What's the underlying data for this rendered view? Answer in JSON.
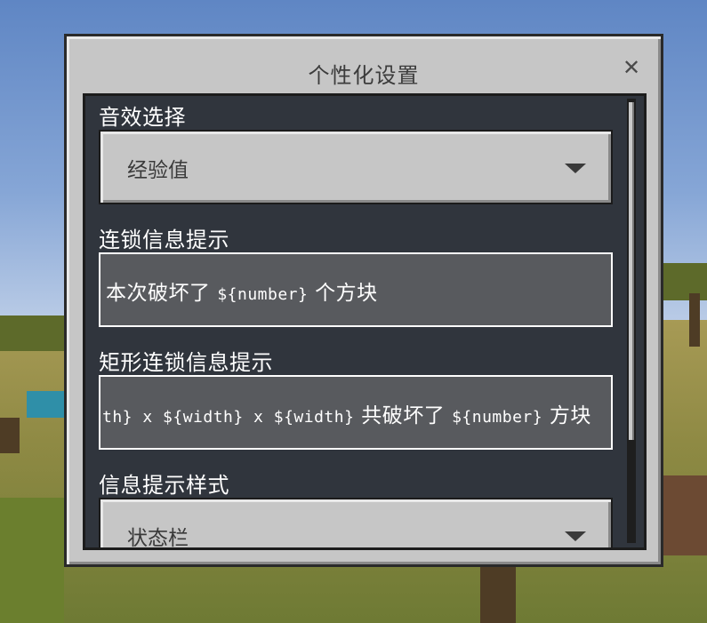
{
  "dialog": {
    "title": "个性化设置",
    "close_glyph": "✕"
  },
  "settings": {
    "sound": {
      "label": "音效选择",
      "selected": "经验值"
    },
    "chain_message": {
      "label": "连锁信息提示",
      "value_prefix": "本次破坏了 ",
      "value_token": "${number}",
      "value_suffix": " 个方块"
    },
    "rect_chain_message": {
      "label": "矩形连锁信息提示",
      "value_visible_1": "th} x ${width} x ${width}",
      "value_visible_2": " 共破坏了 ",
      "value_token": "${number}",
      "value_suffix": " 方块"
    },
    "message_style": {
      "label": "信息提示样式",
      "selected": "状态栏"
    }
  },
  "icons": {
    "close": "close-icon",
    "dropdown": "chevron-down-icon"
  },
  "colors": {
    "panel_bg": "#30353d",
    "dialog_bg": "#c6c6c6",
    "field_bg": "#585a5e"
  }
}
